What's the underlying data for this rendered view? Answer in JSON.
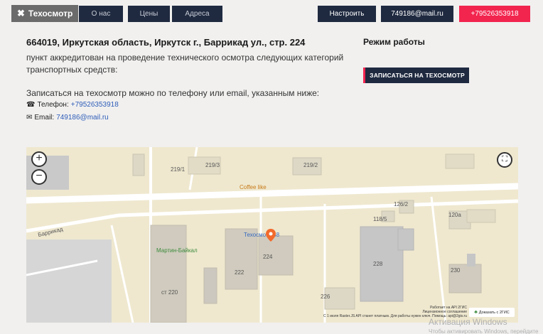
{
  "nav": {
    "brand": "Техосмотр",
    "about": "О нас",
    "prices": "Цены",
    "addresses": "Адреса",
    "config": "Настроить",
    "email": "749186@mail.ru",
    "phone": "+79526353918"
  },
  "main": {
    "address": "664019, Иркутская область, Иркутск г., Баррикад ул., стр. 224",
    "description": "пункт аккредитован на проведение технического осмотра следующих категорий транспортных средств:",
    "signup_text": "Записаться на техосмотр можно по телефону или email, указанным ниже:",
    "phone_label": "Телефон:",
    "phone_value": "+79526353918",
    "email_label": "Email:",
    "email_value": "749186@mail.ru"
  },
  "side": {
    "hours_title": "Режим работы",
    "signup_button": "ЗАПИСАТЬСЯ НА ТЕХОСМОТР"
  },
  "map": {
    "zoom_in": "+",
    "zoom_out": "−",
    "fullscreen": "⛶",
    "labels": {
      "b219_1": "219/1",
      "b219_3": "219/3",
      "b219_2": "219/2",
      "coffee": "Coffee like",
      "b126_2": "126/2",
      "b118_5": "118/5",
      "b120a": "120а",
      "barrikad": "Баррикад",
      "tehosmotr": "Техосмотр 38",
      "martin": "Мартин-Байкал",
      "b222": "222",
      "b224": "224",
      "b228": "228",
      "b230": "230",
      "st220": "ст 220",
      "b226": "226"
    },
    "attrib_1": "Работает на API 2ГИС",
    "attrib_2": "Лицензионное соглашение",
    "attrib_3": "С 1 июля Raster.JS API станет платным. Для работы нужен ключ. Помощь: api@2gis.ru",
    "gis_button": "Доказать с 2ГИС"
  },
  "os": {
    "watermark": "Активация Windows",
    "watermark_sub": "Чтобы активировать Windows, перейдите"
  }
}
